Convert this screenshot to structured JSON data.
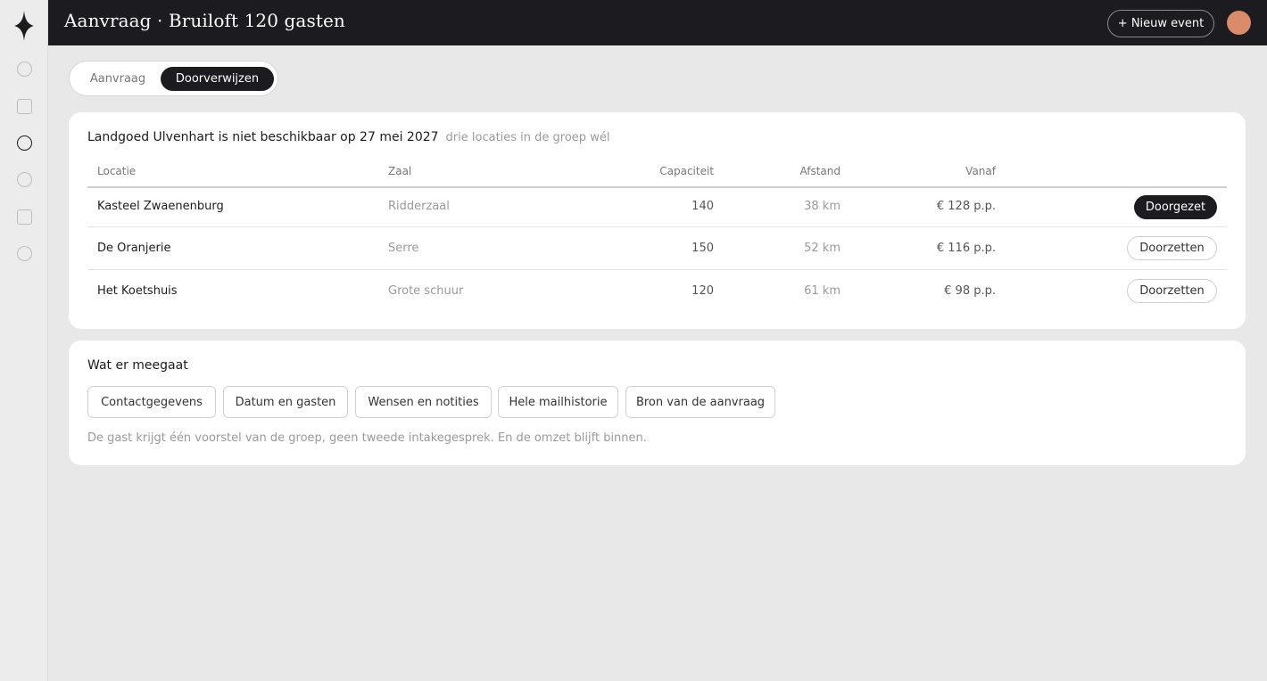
{
  "header": {
    "title": "Aanvraag · Bruiloft 120 gasten",
    "new_event_label": "+ Nieuw event"
  },
  "rail": {
    "icons": [
      "diamond-logo-icon",
      "circle-icon",
      "square-icon",
      "circle-icon",
      "circle-icon",
      "square-icon",
      "circle-icon"
    ]
  },
  "tabs": {
    "items": [
      "Aanvraag",
      "Doorverwijzen"
    ],
    "active": "Doorverwijzen"
  },
  "availability": {
    "headline": "Landgoed Ulvenhart is niet beschikbaar op 27 mei 2027",
    "subline": "drie locaties in de groep wél",
    "columns": [
      "Locatie",
      "Zaal",
      "Capaciteit",
      "Afstand",
      "Vanaf"
    ],
    "rows": [
      {
        "location": "Kasteel Zwaenenburg",
        "room": "Ridderzaal",
        "capacity": "140",
        "distance": "38 km",
        "from": "€ 128 p.p.",
        "action": "Doorgezet"
      },
      {
        "location": "De Oranjerie",
        "room": "Serre",
        "capacity": "150",
        "distance": "52 km",
        "from": "€ 116 p.p.",
        "action": "Doorzetten"
      },
      {
        "location": "Het Koetshuis",
        "room": "Grote schuur",
        "capacity": "120",
        "distance": "61 km",
        "from": "€ 98 p.p.",
        "action": "Doorzetten"
      }
    ]
  },
  "included": {
    "title": "Wat er meegaat",
    "chips": [
      "Contactgegevens",
      "Datum en gasten",
      "Wensen en notities",
      "Hele mailhistorie",
      "Bron van de aanvraag"
    ],
    "note": "De gast krijgt één voorstel van de groep, geen tweede intakegesprek. En de omzet blijft binnen."
  },
  "colors": {
    "dark": "#1c1b1f",
    "background": "#e8e8e8",
    "card": "#ffffff",
    "avatar": "#d98b6a",
    "muted_text": "#9a9a9a"
  }
}
